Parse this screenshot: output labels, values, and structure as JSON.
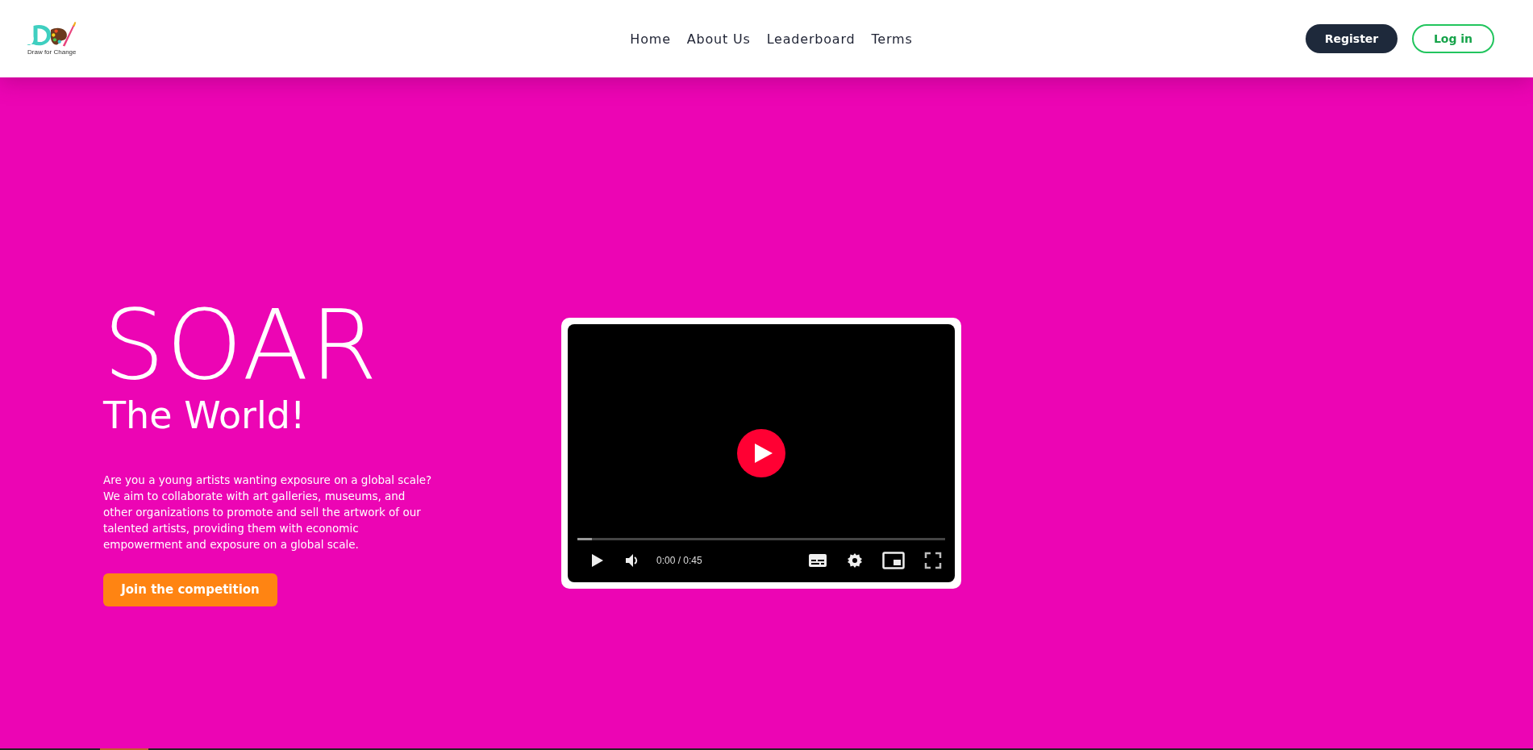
{
  "header": {
    "logo": {
      "caption": "Draw for Change"
    },
    "nav": [
      {
        "label": "Home"
      },
      {
        "label": "About Us"
      },
      {
        "label": "Leaderboard"
      },
      {
        "label": "Terms"
      }
    ],
    "register": "Register",
    "login": "Log in"
  },
  "hero": {
    "title": "SOAR",
    "subtitle": "The World!",
    "body": "Are you a young artists wanting exposure on a global scale? We aim to collaborate with art galleries, museums, and other organizations to promote and sell the artwork of our talented artists, providing them with economic empowerment and exposure on a global scale.",
    "cta": "Join the competition"
  },
  "video": {
    "time": "0:00 / 0:45",
    "progress": {
      "level": 0.04
    }
  }
}
